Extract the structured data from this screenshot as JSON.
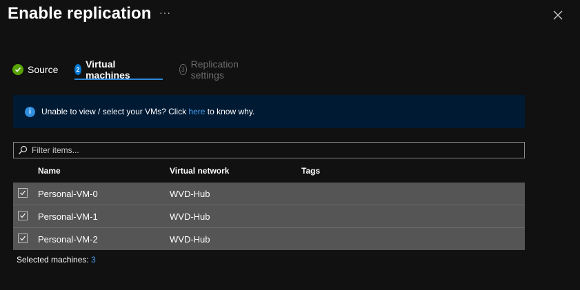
{
  "header": {
    "title": "Enable replication",
    "more_label": "···"
  },
  "steps": [
    {
      "number": "1",
      "label": "Source",
      "state": "completed"
    },
    {
      "number": "2",
      "label": "Virtual machines",
      "state": "active"
    },
    {
      "number": "3",
      "label": "Replication settings",
      "state": "disabled"
    }
  ],
  "info_banner": {
    "text_before": "Unable to view / select your VMs? Click ",
    "link_text": "here",
    "text_after": " to know why."
  },
  "filter": {
    "placeholder": "Filter items...",
    "value": ""
  },
  "table": {
    "columns": [
      "Name",
      "Virtual network",
      "Tags"
    ],
    "rows": [
      {
        "name": "Personal-VM-0",
        "virtual_network": "WVD-Hub",
        "tags": "",
        "checked": true
      },
      {
        "name": "Personal-VM-1",
        "virtual_network": "WVD-Hub",
        "tags": "",
        "checked": true
      },
      {
        "name": "Personal-VM-2",
        "virtual_network": "WVD-Hub",
        "tags": "",
        "checked": true
      }
    ]
  },
  "footer": {
    "selected_label": "Selected machines: ",
    "selected_count": "3"
  },
  "colors": {
    "background": "#111111",
    "info_background": "#011a34",
    "accent": "#0078d4",
    "link": "#4aa0f0",
    "success": "#57a300",
    "row_background": "#555555"
  }
}
